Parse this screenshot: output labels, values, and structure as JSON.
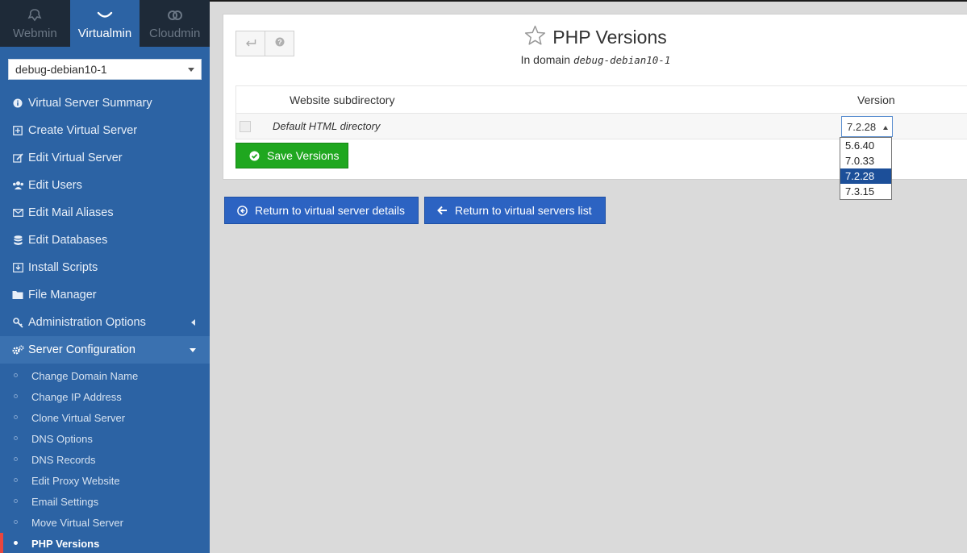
{
  "top_tabs": [
    {
      "label": "Webmin",
      "icon": "webmin-icon",
      "active": false
    },
    {
      "label": "Virtualmin",
      "icon": "virtualmin-icon",
      "active": true
    },
    {
      "label": "Cloudmin",
      "icon": "cloudmin-icon",
      "active": false
    }
  ],
  "domain_select": {
    "value": "debug-debian10-1"
  },
  "menu": [
    {
      "label": "Virtual Server Summary",
      "icon": "info-icon"
    },
    {
      "label": "Create Virtual Server",
      "icon": "plus-square-icon"
    },
    {
      "label": "Edit Virtual Server",
      "icon": "edit-icon"
    },
    {
      "label": "Edit Users",
      "icon": "users-icon"
    },
    {
      "label": "Edit Mail Aliases",
      "icon": "envelope-icon"
    },
    {
      "label": "Edit Databases",
      "icon": "database-icon"
    },
    {
      "label": "Install Scripts",
      "icon": "install-icon"
    },
    {
      "label": "File Manager",
      "icon": "folder-icon"
    },
    {
      "label": "Administration Options",
      "icon": "key-icon"
    },
    {
      "label": "Server Configuration",
      "icon": "gears-icon"
    }
  ],
  "submenu": [
    "Change Domain Name",
    "Change IP Address",
    "Clone Virtual Server",
    "DNS Options",
    "DNS Records",
    "Edit Proxy Website",
    "Email Settings",
    "Move Virtual Server",
    "PHP Versions"
  ],
  "page": {
    "title": "PHP Versions",
    "subtitle_prefix": "In domain",
    "subtitle_domain": "debug-debian10-1"
  },
  "table": {
    "headers": {
      "directory": "Website subdirectory",
      "version": "Version"
    },
    "rows": [
      {
        "directory": "Default HTML directory",
        "version": "7.2.28"
      }
    ]
  },
  "version_options": [
    "5.6.40",
    "7.0.33",
    "7.2.28",
    "7.3.15"
  ],
  "selected_version": "7.2.28",
  "buttons": {
    "save": "Save Versions",
    "return_details": "Return to virtual server details",
    "return_list": "Return to virtual servers list"
  },
  "colors": {
    "sidebar": "#2c63a4",
    "topbar": "#1e2a38",
    "save_button": "#1fa71f",
    "primary_button": "#2c63c2",
    "active_marker": "#e8463e"
  }
}
